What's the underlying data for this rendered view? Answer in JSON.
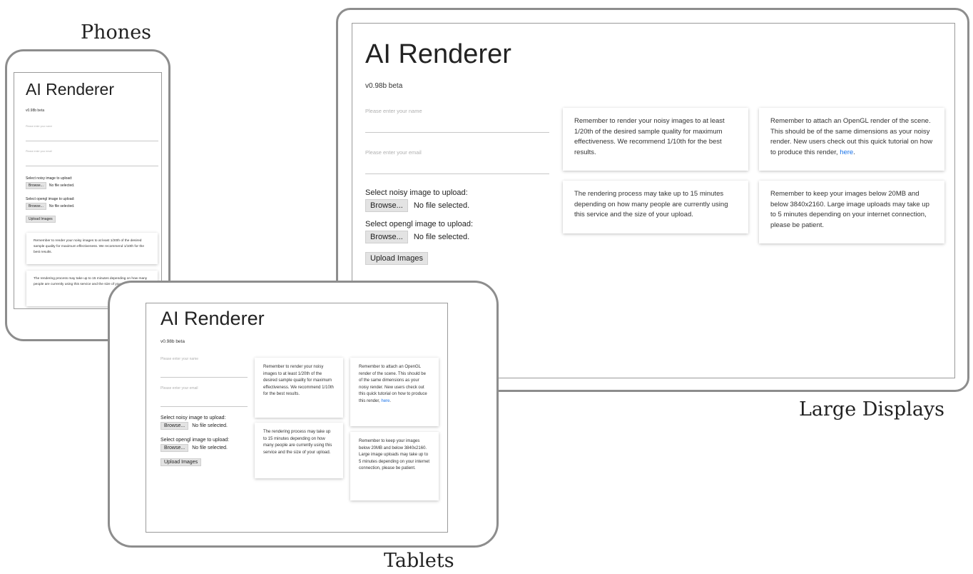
{
  "captions": {
    "phones": "Phones",
    "large": "Large Displays",
    "tablets": "Tablets"
  },
  "app": {
    "title": "AI Renderer",
    "version": "v0.98b beta",
    "name_placeholder": "Please enter your name",
    "email_placeholder": "Please enter your email",
    "noisy_label": "Select noisy image to upload:",
    "opengl_label": "Select opengl image to upload:",
    "browse_label": "Browse...",
    "no_file_text": "No file selected.",
    "upload_button": "Upload Images"
  },
  "cards": {
    "quality": "Remember to render your noisy images to at least 1/20th of the desired sample quality for maximum effectiveness. We recommend 1/10th for the best results.",
    "opengl_text": "Remember to attach an OpenGL render of the scene. This should be of the same dimensions as your noisy render. New users check out this quick tutorial on how to produce this render,",
    "opengl_link": "here",
    "timing": "The rendering process may take up to 15 minutes depending on how many people are currently using this service and the size of your upload.",
    "size": "Remember to keep your images below 20MB and below 3840x2160. Large image uploads may take up to 5 minutes depending on your internet connection, please be patient."
  },
  "colors": {
    "link": "#1a73e8",
    "device_frame": "#8d8d8d"
  }
}
